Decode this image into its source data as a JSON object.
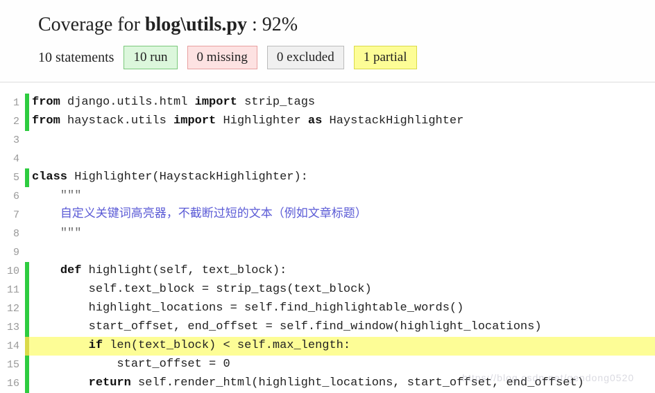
{
  "header": {
    "prefix": "Coverage for ",
    "file": "blog\\utils.py",
    "pct_sep": " : ",
    "pct": "92%",
    "statements": "10 statements",
    "run": "10 run",
    "missing": "0 missing",
    "excluded": "0 excluded",
    "partial": "1 partial"
  },
  "code": {
    "lines": [
      {
        "n": 1,
        "status": "run",
        "tokens": [
          [
            "kw",
            "from"
          ],
          [
            "",
            " django.utils.html "
          ],
          [
            "kw",
            "import"
          ],
          [
            "",
            " strip_tags"
          ]
        ]
      },
      {
        "n": 2,
        "status": "run",
        "tokens": [
          [
            "kw",
            "from"
          ],
          [
            "",
            " haystack.utils "
          ],
          [
            "kw",
            "import"
          ],
          [
            "",
            " Highlighter "
          ],
          [
            "kw",
            "as"
          ],
          [
            "",
            " HaystackHighlighter"
          ]
        ]
      },
      {
        "n": 3,
        "status": "",
        "tokens": [
          [
            "",
            ""
          ]
        ]
      },
      {
        "n": 4,
        "status": "",
        "tokens": [
          [
            "",
            ""
          ]
        ]
      },
      {
        "n": 5,
        "status": "run",
        "tokens": [
          [
            "kw",
            "class"
          ],
          [
            "",
            " Highlighter(HaystackHighlighter):"
          ]
        ]
      },
      {
        "n": 6,
        "status": "",
        "tokens": [
          [
            "",
            "    "
          ],
          [
            "str",
            "\"\"\""
          ]
        ]
      },
      {
        "n": 7,
        "status": "",
        "tokens": [
          [
            "",
            "    "
          ],
          [
            "cmt",
            "自定义关键词高亮器，不截断过短的文本（例如文章标题）"
          ]
        ]
      },
      {
        "n": 8,
        "status": "",
        "tokens": [
          [
            "",
            "    "
          ],
          [
            "str",
            "\"\"\""
          ]
        ]
      },
      {
        "n": 9,
        "status": "",
        "tokens": [
          [
            "",
            ""
          ]
        ]
      },
      {
        "n": 10,
        "status": "run",
        "tokens": [
          [
            "",
            "    "
          ],
          [
            "kw",
            "def"
          ],
          [
            "",
            " highlight(self, text_block):"
          ]
        ]
      },
      {
        "n": 11,
        "status": "run",
        "tokens": [
          [
            "",
            "        self.text_block = strip_tags(text_block)"
          ]
        ]
      },
      {
        "n": 12,
        "status": "run",
        "tokens": [
          [
            "",
            "        highlight_locations = self.find_highlightable_words()"
          ]
        ]
      },
      {
        "n": 13,
        "status": "run",
        "tokens": [
          [
            "",
            "        start_offset, end_offset = self.find_window(highlight_locations)"
          ]
        ]
      },
      {
        "n": 14,
        "status": "partial",
        "tokens": [
          [
            "",
            "        "
          ],
          [
            "kw",
            "if"
          ],
          [
            "",
            " len(text_block) < self.max_length:"
          ]
        ]
      },
      {
        "n": 15,
        "status": "run",
        "tokens": [
          [
            "",
            "            start_offset = 0"
          ]
        ]
      },
      {
        "n": 16,
        "status": "run",
        "tokens": [
          [
            "",
            "        "
          ],
          [
            "kw",
            "return"
          ],
          [
            "",
            " self.render_html(highlight_locations, start_offset, end_offset)"
          ]
        ]
      }
    ]
  },
  "watermark": "https://blog.csdn.net/gendong0520"
}
